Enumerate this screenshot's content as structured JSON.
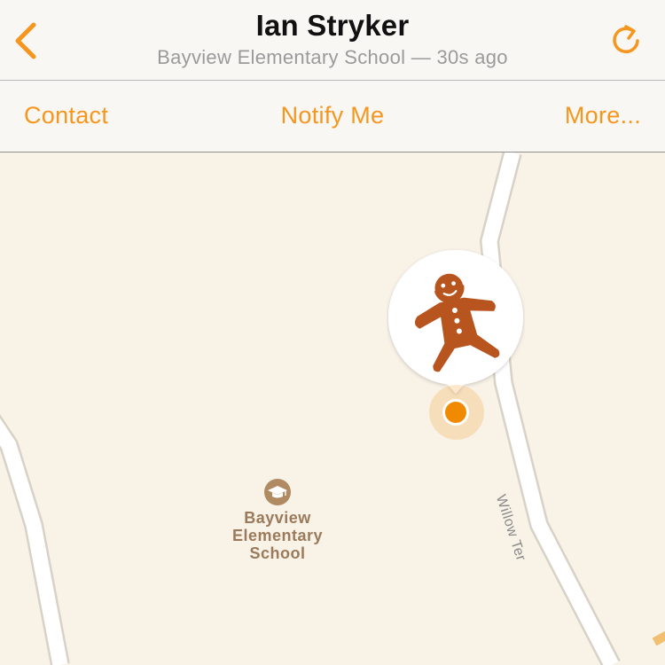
{
  "nav": {
    "back_icon": "chevron-left-icon",
    "title": "Ian Stryker",
    "subtitle": "Bayview Elementary School — 30s ago",
    "refresh_icon": "refresh-icon"
  },
  "actions": {
    "contact": "Contact",
    "notify": "Notify Me",
    "more": "More..."
  },
  "map": {
    "street_label": "Willow Ter",
    "poi": {
      "icon": "graduation-cap-icon",
      "label": "Bayview\nElementary\nSchool"
    },
    "pin": {
      "avatar": "gingerbread-man-icon"
    }
  },
  "colors": {
    "accent": "#f5961e",
    "map_background": "#f8f2e7",
    "poi_text": "#9a7a5a"
  }
}
